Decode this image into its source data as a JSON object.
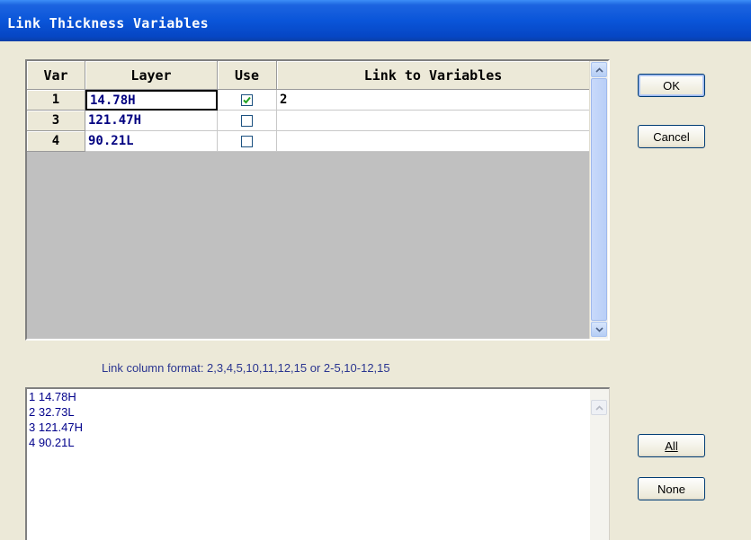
{
  "window": {
    "title": "Link Thickness Variables"
  },
  "grid": {
    "headers": [
      "Var",
      "Layer",
      "Use",
      "Link to Variables"
    ],
    "rows": [
      {
        "var": "1",
        "layer": "14.78H",
        "use": true,
        "link": "2"
      },
      {
        "var": "3",
        "layer": "121.47H",
        "use": false,
        "link": ""
      },
      {
        "var": "4",
        "layer": "90.21L",
        "use": false,
        "link": ""
      }
    ]
  },
  "buttons": {
    "ok": "OK",
    "cancel": "Cancel",
    "all": "All",
    "none": "None"
  },
  "hint": "Link column format: 2,3,4,5,10,11,12,15  or  2-5,10-12,15",
  "layer_list": [
    "1 14.78H",
    "2 32.73L",
    "3 121.47H",
    "4 90.21L"
  ],
  "icons": {
    "scroll_up": "chevron-up-icon",
    "scroll_down": "chevron-down-icon",
    "check": "checkmark-icon"
  },
  "colors": {
    "titlebar": "#0a55d9",
    "checkmark": "#21a121",
    "layer_text": "#000080"
  }
}
